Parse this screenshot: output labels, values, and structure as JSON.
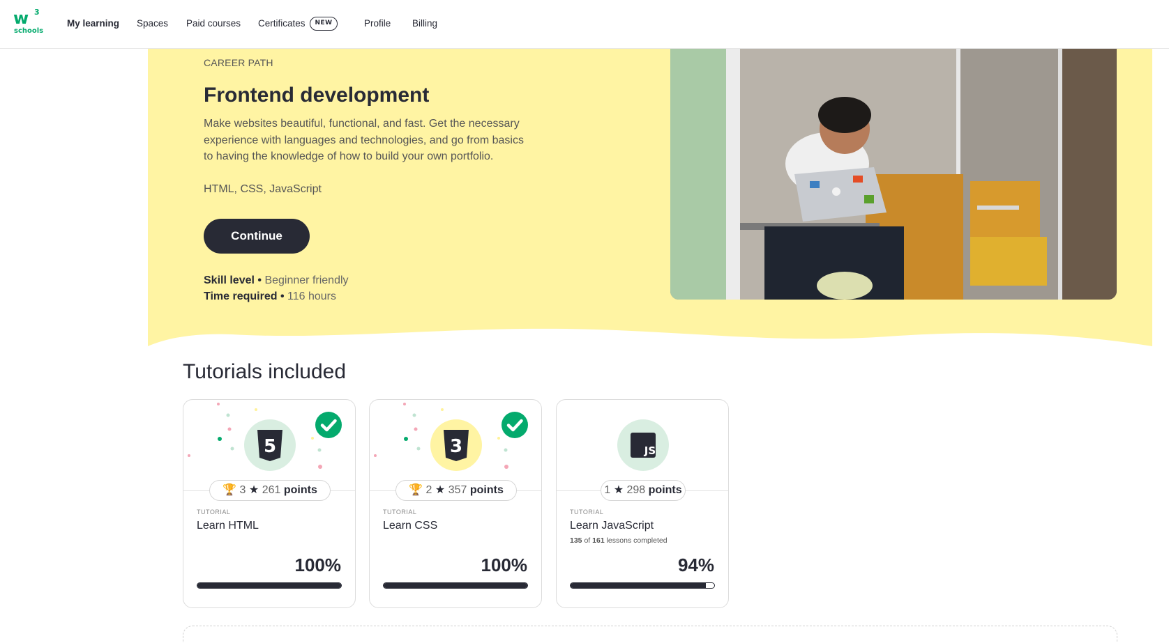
{
  "nav": {
    "logo_main": "w",
    "logo_sup": "3",
    "logo_sub": "schools",
    "items": [
      {
        "label": "My learning"
      },
      {
        "label": "Spaces"
      },
      {
        "label": "Paid courses"
      },
      {
        "label": "Certificates"
      },
      {
        "label": "Profile"
      },
      {
        "label": "Billing"
      }
    ],
    "new_badge": "NEW"
  },
  "hero": {
    "eyebrow": "CAREER PATH",
    "title": "Frontend development",
    "description": "Make websites beautiful, functional, and fast. Get the necessary experience with languages and technologies, and go from basics to having the knowledge of how to build your own portfolio.",
    "technologies": "HTML, CSS, JavaScript",
    "cta_label": "Continue",
    "skill_label": "Skill level",
    "skill_value": "Beginner friendly",
    "time_label": "Time required",
    "time_value": "116 hours",
    "separator": "•"
  },
  "tutorials": {
    "section_title": "Tutorials included",
    "cards": [
      {
        "type": "TUTORIAL",
        "name": "Learn HTML",
        "trophies": "3",
        "points": "261",
        "points_label": "points",
        "percent": "100%",
        "progress": 1.0,
        "lessons_done": "",
        "lessons_of": "",
        "lessons_total": "",
        "lessons_suffix": "",
        "icon": "html5-icon",
        "icon_glyph": "5",
        "circle_color": "#d9eee1",
        "completed": true
      },
      {
        "type": "TUTORIAL",
        "name": "Learn CSS",
        "trophies": "2",
        "points": "357",
        "points_label": "points",
        "percent": "100%",
        "progress": 1.0,
        "lessons_done": "",
        "lessons_of": "",
        "lessons_total": "",
        "lessons_suffix": "",
        "icon": "css3-icon",
        "icon_glyph": "3",
        "circle_color": "#fff4a3",
        "completed": true
      },
      {
        "type": "TUTORIAL",
        "name": "Learn JavaScript",
        "trophies": "1",
        "points": "298",
        "points_label": "points",
        "percent": "94%",
        "progress": 0.94,
        "lessons_done": "135",
        "lessons_of": "of",
        "lessons_total": "161",
        "lessons_suffix": "lessons completed",
        "icon": "javascript-icon",
        "icon_glyph": "JS",
        "circle_color": "#d9eee1",
        "completed": false
      }
    ]
  },
  "colors": {
    "brand_green": "#04aa6d",
    "hero_yellow": "#fff4a3",
    "dark": "#282a35"
  }
}
